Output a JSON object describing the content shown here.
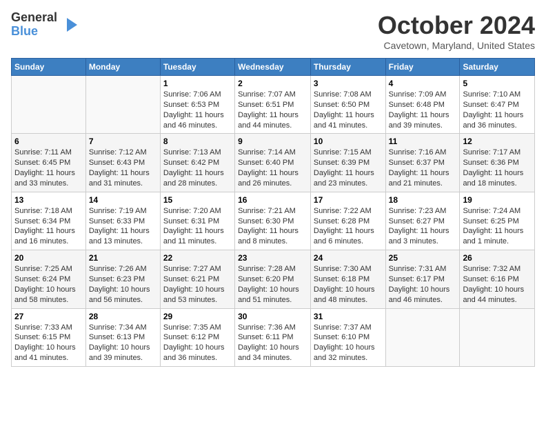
{
  "logo": {
    "general": "General",
    "blue": "Blue"
  },
  "title": "October 2024",
  "location": "Cavetown, Maryland, United States",
  "days_of_week": [
    "Sunday",
    "Monday",
    "Tuesday",
    "Wednesday",
    "Thursday",
    "Friday",
    "Saturday"
  ],
  "weeks": [
    [
      {
        "day": "",
        "sunrise": "",
        "sunset": "",
        "daylight": ""
      },
      {
        "day": "",
        "sunrise": "",
        "sunset": "",
        "daylight": ""
      },
      {
        "day": "1",
        "sunrise": "Sunrise: 7:06 AM",
        "sunset": "Sunset: 6:53 PM",
        "daylight": "Daylight: 11 hours and 46 minutes."
      },
      {
        "day": "2",
        "sunrise": "Sunrise: 7:07 AM",
        "sunset": "Sunset: 6:51 PM",
        "daylight": "Daylight: 11 hours and 44 minutes."
      },
      {
        "day": "3",
        "sunrise": "Sunrise: 7:08 AM",
        "sunset": "Sunset: 6:50 PM",
        "daylight": "Daylight: 11 hours and 41 minutes."
      },
      {
        "day": "4",
        "sunrise": "Sunrise: 7:09 AM",
        "sunset": "Sunset: 6:48 PM",
        "daylight": "Daylight: 11 hours and 39 minutes."
      },
      {
        "day": "5",
        "sunrise": "Sunrise: 7:10 AM",
        "sunset": "Sunset: 6:47 PM",
        "daylight": "Daylight: 11 hours and 36 minutes."
      }
    ],
    [
      {
        "day": "6",
        "sunrise": "Sunrise: 7:11 AM",
        "sunset": "Sunset: 6:45 PM",
        "daylight": "Daylight: 11 hours and 33 minutes."
      },
      {
        "day": "7",
        "sunrise": "Sunrise: 7:12 AM",
        "sunset": "Sunset: 6:43 PM",
        "daylight": "Daylight: 11 hours and 31 minutes."
      },
      {
        "day": "8",
        "sunrise": "Sunrise: 7:13 AM",
        "sunset": "Sunset: 6:42 PM",
        "daylight": "Daylight: 11 hours and 28 minutes."
      },
      {
        "day": "9",
        "sunrise": "Sunrise: 7:14 AM",
        "sunset": "Sunset: 6:40 PM",
        "daylight": "Daylight: 11 hours and 26 minutes."
      },
      {
        "day": "10",
        "sunrise": "Sunrise: 7:15 AM",
        "sunset": "Sunset: 6:39 PM",
        "daylight": "Daylight: 11 hours and 23 minutes."
      },
      {
        "day": "11",
        "sunrise": "Sunrise: 7:16 AM",
        "sunset": "Sunset: 6:37 PM",
        "daylight": "Daylight: 11 hours and 21 minutes."
      },
      {
        "day": "12",
        "sunrise": "Sunrise: 7:17 AM",
        "sunset": "Sunset: 6:36 PM",
        "daylight": "Daylight: 11 hours and 18 minutes."
      }
    ],
    [
      {
        "day": "13",
        "sunrise": "Sunrise: 7:18 AM",
        "sunset": "Sunset: 6:34 PM",
        "daylight": "Daylight: 11 hours and 16 minutes."
      },
      {
        "day": "14",
        "sunrise": "Sunrise: 7:19 AM",
        "sunset": "Sunset: 6:33 PM",
        "daylight": "Daylight: 11 hours and 13 minutes."
      },
      {
        "day": "15",
        "sunrise": "Sunrise: 7:20 AM",
        "sunset": "Sunset: 6:31 PM",
        "daylight": "Daylight: 11 hours and 11 minutes."
      },
      {
        "day": "16",
        "sunrise": "Sunrise: 7:21 AM",
        "sunset": "Sunset: 6:30 PM",
        "daylight": "Daylight: 11 hours and 8 minutes."
      },
      {
        "day": "17",
        "sunrise": "Sunrise: 7:22 AM",
        "sunset": "Sunset: 6:28 PM",
        "daylight": "Daylight: 11 hours and 6 minutes."
      },
      {
        "day": "18",
        "sunrise": "Sunrise: 7:23 AM",
        "sunset": "Sunset: 6:27 PM",
        "daylight": "Daylight: 11 hours and 3 minutes."
      },
      {
        "day": "19",
        "sunrise": "Sunrise: 7:24 AM",
        "sunset": "Sunset: 6:25 PM",
        "daylight": "Daylight: 11 hours and 1 minute."
      }
    ],
    [
      {
        "day": "20",
        "sunrise": "Sunrise: 7:25 AM",
        "sunset": "Sunset: 6:24 PM",
        "daylight": "Daylight: 10 hours and 58 minutes."
      },
      {
        "day": "21",
        "sunrise": "Sunrise: 7:26 AM",
        "sunset": "Sunset: 6:23 PM",
        "daylight": "Daylight: 10 hours and 56 minutes."
      },
      {
        "day": "22",
        "sunrise": "Sunrise: 7:27 AM",
        "sunset": "Sunset: 6:21 PM",
        "daylight": "Daylight: 10 hours and 53 minutes."
      },
      {
        "day": "23",
        "sunrise": "Sunrise: 7:28 AM",
        "sunset": "Sunset: 6:20 PM",
        "daylight": "Daylight: 10 hours and 51 minutes."
      },
      {
        "day": "24",
        "sunrise": "Sunrise: 7:30 AM",
        "sunset": "Sunset: 6:18 PM",
        "daylight": "Daylight: 10 hours and 48 minutes."
      },
      {
        "day": "25",
        "sunrise": "Sunrise: 7:31 AM",
        "sunset": "Sunset: 6:17 PM",
        "daylight": "Daylight: 10 hours and 46 minutes."
      },
      {
        "day": "26",
        "sunrise": "Sunrise: 7:32 AM",
        "sunset": "Sunset: 6:16 PM",
        "daylight": "Daylight: 10 hours and 44 minutes."
      }
    ],
    [
      {
        "day": "27",
        "sunrise": "Sunrise: 7:33 AM",
        "sunset": "Sunset: 6:15 PM",
        "daylight": "Daylight: 10 hours and 41 minutes."
      },
      {
        "day": "28",
        "sunrise": "Sunrise: 7:34 AM",
        "sunset": "Sunset: 6:13 PM",
        "daylight": "Daylight: 10 hours and 39 minutes."
      },
      {
        "day": "29",
        "sunrise": "Sunrise: 7:35 AM",
        "sunset": "Sunset: 6:12 PM",
        "daylight": "Daylight: 10 hours and 36 minutes."
      },
      {
        "day": "30",
        "sunrise": "Sunrise: 7:36 AM",
        "sunset": "Sunset: 6:11 PM",
        "daylight": "Daylight: 10 hours and 34 minutes."
      },
      {
        "day": "31",
        "sunrise": "Sunrise: 7:37 AM",
        "sunset": "Sunset: 6:10 PM",
        "daylight": "Daylight: 10 hours and 32 minutes."
      },
      {
        "day": "",
        "sunrise": "",
        "sunset": "",
        "daylight": ""
      },
      {
        "day": "",
        "sunrise": "",
        "sunset": "",
        "daylight": ""
      }
    ]
  ]
}
